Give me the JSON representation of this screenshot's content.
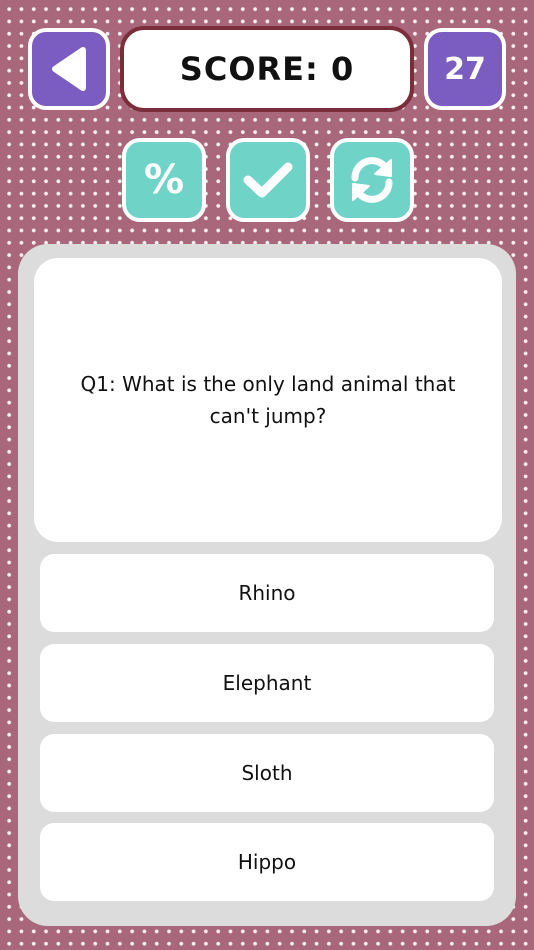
{
  "header": {
    "back_icon": "left-triangle-icon",
    "score_label": "SCORE: 0",
    "timer_value": "27"
  },
  "toolbar": {
    "percent_symbol": "%",
    "check_icon": "checkmark-icon",
    "refresh_icon": "refresh-icon"
  },
  "question": {
    "text": "Q1: What is the only land animal that can't jump?"
  },
  "answers": [
    {
      "label": "Rhino"
    },
    {
      "label": "Elephant"
    },
    {
      "label": "Sloth"
    },
    {
      "label": "Hippo"
    }
  ],
  "colors": {
    "background": "#a8677a",
    "purple": "#7b5cc0",
    "teal": "#6fd4c7",
    "score_border": "#7a2e3c"
  }
}
